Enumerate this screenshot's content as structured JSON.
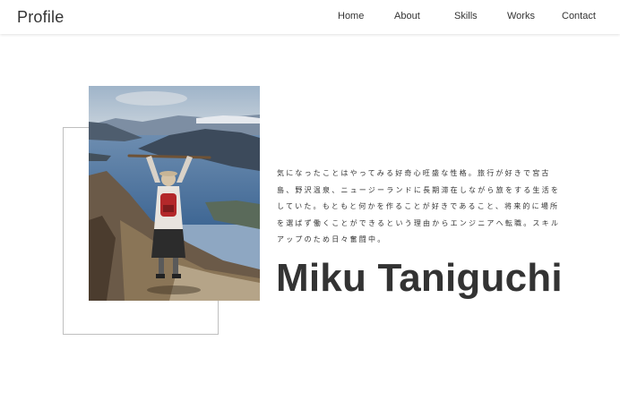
{
  "header": {
    "logo": "Profile",
    "nav": [
      "Home",
      "About",
      "Skills",
      "Works",
      "Contact"
    ]
  },
  "profile": {
    "bio": "気になったことはやってみる好奇心旺盛な性格。旅行が好きで宮古島、野沢温泉、ニュージーランドに長期滞在しながら旅をする生活をしていた。もともと何かを作ることが好きであること、将来的に場所を選ばず働くことができるという理由からエンジニアへ転職。スキルアップのため日々奮闘中。",
    "name": "Miku Taniguchi"
  },
  "colors": {
    "text": "#333333",
    "frame": "#bfbfbf",
    "background": "#ffffff"
  }
}
